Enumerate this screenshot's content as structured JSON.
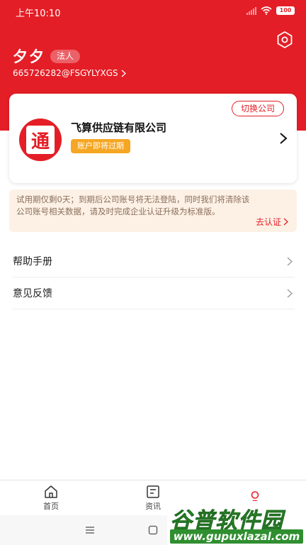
{
  "status_bar": {
    "time": "上午10:10",
    "battery": "100"
  },
  "profile": {
    "name": "夕夕",
    "role": "法人",
    "account": "665726282@FSGYLYXGS"
  },
  "company_card": {
    "switch_label": "切换公司",
    "logo_char": "通",
    "name": "飞算供应链有限公司",
    "status": "账户即将过期"
  },
  "notice": {
    "line1": "试用期仅剩0天；到期后公司账号将无法登陆，同时我们将清除该",
    "line2": "公司账号相关数据，请及时完成企业认证升级为标准版。",
    "action": "去认证"
  },
  "menu": [
    {
      "label": "帮助手册"
    },
    {
      "label": "意见反馈"
    }
  ],
  "tabbar": [
    {
      "label": "首页",
      "icon": "home-icon"
    },
    {
      "label": "资讯",
      "icon": "news-icon"
    },
    {
      "label": "",
      "icon": "person-icon"
    }
  ],
  "watermark": {
    "title": "谷普软件园",
    "url": "www.gupuxlazal.com"
  },
  "colors": {
    "brand": "#e41e26",
    "warning": "#f5a623",
    "notice_bg": "#fdf1e6",
    "watermark": "#2f8f2f"
  },
  "icons": [
    "settings-icon",
    "chevron-right-icon",
    "wifi-icon",
    "signal-icon",
    "battery-icon",
    "menu-lines-icon",
    "home-square-icon"
  ]
}
